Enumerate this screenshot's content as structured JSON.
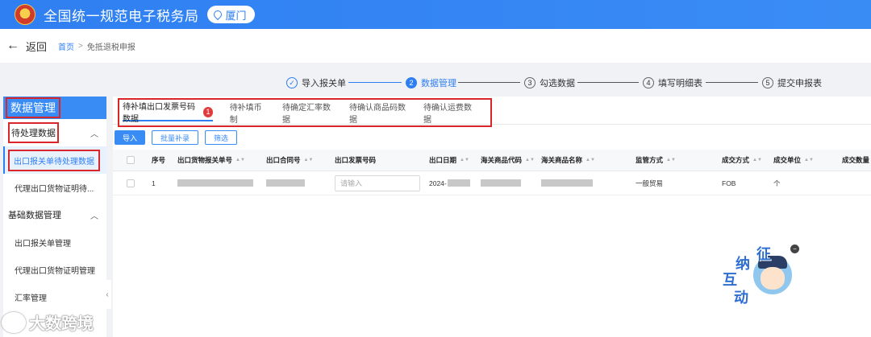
{
  "header": {
    "title": "全国统一规范电子税务局",
    "city": "厦门",
    "emblem_icon": "national-emblem-icon"
  },
  "nav": {
    "back_label": "返回",
    "breadcrumb": [
      "首页",
      "免抵退税申报"
    ],
    "separator": ">"
  },
  "steps": [
    {
      "num": "✓",
      "label": "导入报关单",
      "state": "done"
    },
    {
      "num": "2",
      "label": "数据管理",
      "state": "active"
    },
    {
      "num": "3",
      "label": "勾选数据",
      "state": "todo"
    },
    {
      "num": "4",
      "label": "填写明细表",
      "state": "todo"
    },
    {
      "num": "5",
      "label": "提交申报表",
      "state": "todo"
    }
  ],
  "sidebar": {
    "title": "数据管理",
    "groups": [
      {
        "label": "待处理数据",
        "items": [
          "出口报关单待处理数据",
          "代理出口货物证明待..."
        ]
      },
      {
        "label": "基础数据管理",
        "items": [
          "出口报关单管理",
          "代理出口货物证明管理",
          "汇率管理"
        ]
      }
    ]
  },
  "tabs": [
    {
      "label": "待补填出口发票号码数据",
      "badge": "1",
      "active": true
    },
    {
      "label": "待补填币制"
    },
    {
      "label": "待确定汇率数据"
    },
    {
      "label": "待确认商品码数据"
    },
    {
      "label": "待确认运费数据"
    }
  ],
  "toolbar": {
    "import": "导入",
    "batch_fill": "批量补录",
    "filter": "筛选"
  },
  "table": {
    "columns": [
      "序号",
      "出口货物报关单号",
      "出口合同号",
      "出口发票号码",
      "出口日期",
      "海关商品代码",
      "海关商品名称",
      "监管方式",
      "成交方式",
      "成交单位",
      "成交数量"
    ],
    "rows": [
      {
        "index": "1",
        "invoice_placeholder": "请输入",
        "date_prefix": "2024-",
        "supervision": "一般贸易",
        "deal_method": "FOB",
        "deal_unit": "个"
      }
    ]
  },
  "mascot": {
    "chars": [
      "征",
      "纳",
      "互",
      "动"
    ],
    "close": "−"
  },
  "watermark": {
    "text": "大数跨境"
  },
  "colors": {
    "brand": "#2f7ff2",
    "highlight_box": "#d9262a",
    "badge": "#e03c3c"
  }
}
